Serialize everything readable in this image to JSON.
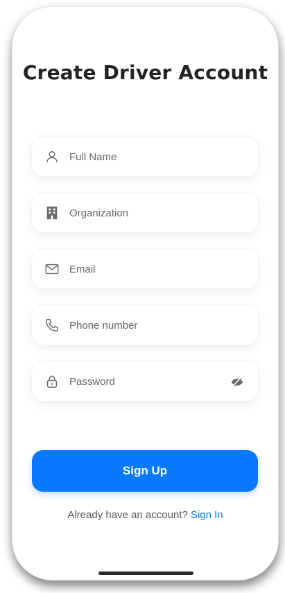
{
  "page": {
    "title": "Create Driver Account"
  },
  "fields": [
    {
      "icon": "user-icon",
      "placeholder": "Full Name",
      "value": ""
    },
    {
      "icon": "building-icon",
      "placeholder": "Organization",
      "value": ""
    },
    {
      "icon": "mail-icon",
      "placeholder": "Email",
      "value": ""
    },
    {
      "icon": "phone-icon",
      "placeholder": "Phone number",
      "value": ""
    },
    {
      "icon": "lock-icon",
      "placeholder": "Password",
      "value": "",
      "toggle_icon": "eye-off-icon"
    }
  ],
  "actions": {
    "signup_label": "Sign Up"
  },
  "footer": {
    "prompt": "Already have an account?",
    "link": "Sign In"
  },
  "colors": {
    "accent": "#0a78ff",
    "text": "#232323",
    "icon": "#6b6b6b"
  }
}
